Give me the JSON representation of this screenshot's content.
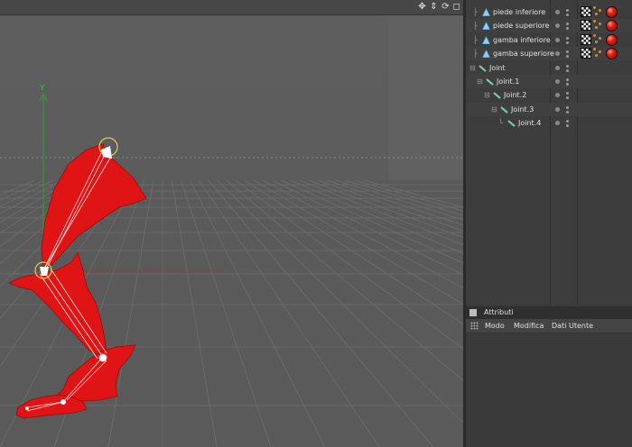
{
  "viewport": {
    "toolbar_icons": [
      "move-view-icon",
      "zoom-view-icon",
      "rotate-view-icon",
      "maximize-view-icon"
    ],
    "axis_label": "Y",
    "mesh_color": "#e01414",
    "background_color": "#5c5c5c"
  },
  "object_manager": {
    "objects": [
      {
        "name": "piede inferiore",
        "type": "polygon",
        "tags": true
      },
      {
        "name": "piede superiore",
        "type": "polygon",
        "tags": true
      },
      {
        "name": "gamba inferiore",
        "type": "polygon",
        "tags": true
      },
      {
        "name": "gamba superiore",
        "type": "polygon",
        "tags": true
      },
      {
        "name": "Joint",
        "type": "joint",
        "tags": false
      },
      {
        "name": "Joint.1",
        "type": "joint",
        "tags": false
      },
      {
        "name": "Joint.2",
        "type": "joint",
        "tags": false
      },
      {
        "name": "Joint.3",
        "type": "joint",
        "tags": false
      },
      {
        "name": "Joint.4",
        "type": "joint",
        "tags": false
      }
    ]
  },
  "attributes": {
    "title": "Attributi",
    "menu": {
      "modo": "Modo",
      "modifica": "Modifica",
      "dati_utente": "Dati Utente"
    }
  }
}
